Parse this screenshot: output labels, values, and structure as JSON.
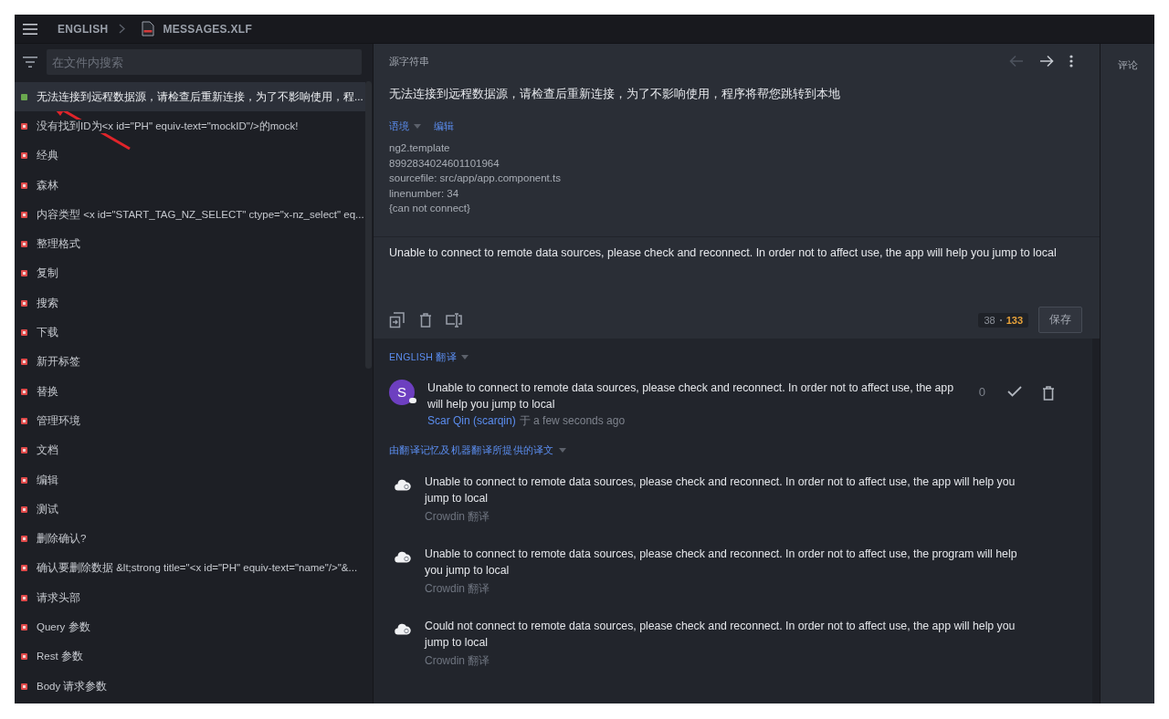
{
  "topbar": {
    "breadcrumb": [
      "ENGLISH",
      "MESSAGES.XLF"
    ]
  },
  "sidebar": {
    "search": {
      "placeholder": "在文件内搜索"
    },
    "items": [
      {
        "text": "无法连接到远程数据源，请检查后重新连接，为了不影响使用，程...",
        "translated": true,
        "selected": true
      },
      {
        "text": "没有找到ID为<x id=\"PH\" equiv-text=\"mockID\"/>的mock!",
        "translated": false,
        "selected": false
      },
      {
        "text": "经典",
        "translated": false,
        "selected": false
      },
      {
        "text": "森林",
        "translated": false,
        "selected": false
      },
      {
        "text": "内容类型 <x id=\"START_TAG_NZ_SELECT\" ctype=\"x-nz_select\" eq...",
        "translated": false,
        "selected": false
      },
      {
        "text": "整理格式",
        "translated": false,
        "selected": false
      },
      {
        "text": "复制",
        "translated": false,
        "selected": false
      },
      {
        "text": "搜索",
        "translated": false,
        "selected": false
      },
      {
        "text": "下载",
        "translated": false,
        "selected": false
      },
      {
        "text": "新开标签",
        "translated": false,
        "selected": false
      },
      {
        "text": "替换",
        "translated": false,
        "selected": false
      },
      {
        "text": "管理环境",
        "translated": false,
        "selected": false
      },
      {
        "text": "文档",
        "translated": false,
        "selected": false
      },
      {
        "text": "编辑",
        "translated": false,
        "selected": false
      },
      {
        "text": "测试",
        "translated": false,
        "selected": false
      },
      {
        "text": "删除确认?",
        "translated": false,
        "selected": false
      },
      {
        "text": "确认要删除数据 &lt;strong title=\"<x id=\"PH\" equiv-text=\"name\"/>\"&...",
        "translated": false,
        "selected": false
      },
      {
        "text": "请求头部",
        "translated": false,
        "selected": false
      },
      {
        "text": "Query 参数",
        "translated": false,
        "selected": false
      },
      {
        "text": "Rest 参数",
        "translated": false,
        "selected": false
      },
      {
        "text": "Body 请求参数",
        "translated": false,
        "selected": false
      }
    ]
  },
  "source": {
    "label": "源字符串",
    "nav": {
      "previous_disabled": true,
      "next_disabled": false
    },
    "text": "无法连接到远程数据源，请检查后重新连接，为了不影响使用，程序将帮您跳转到本地",
    "context_tabs": [
      {
        "label": "语境",
        "kind": "dropdown"
      },
      {
        "label": "编辑",
        "kind": "link"
      }
    ],
    "context_lines": [
      "ng2.template",
      "8992834024601101964",
      "sourcefile: src/app/app.component.ts",
      "linenumber: 34",
      "{can not connect}"
    ]
  },
  "editor": {
    "value": "Unable to connect to remote data sources, please check and reconnect. In order not to affect use, the app will help you jump to local",
    "counter": {
      "source_length": "38",
      "target_length": "133"
    },
    "save_label": "保存"
  },
  "translations": {
    "heading": "ENGLISH 翻译",
    "items": [
      {
        "avatar": "S",
        "text": "Unable to connect to remote data sources, please check and reconnect. In order not to affect use, the app will help you jump to local",
        "author": "Scar Qin (scarqin)",
        "time_prefix": "于",
        "time": "a few seconds ago",
        "votes": "0"
      }
    ]
  },
  "suggestions": {
    "heading": "由翻译记忆及机器翻译所提供的译文",
    "items": [
      {
        "text": "Unable to connect to remote data sources, please check and reconnect. In order not to affect use, the app will help you jump to local",
        "source": "Crowdin 翻译"
      },
      {
        "text": "Unable to connect to remote data sources, please check and reconnect. In order not to affect use, the program will help you jump to local",
        "source": "Crowdin 翻译"
      },
      {
        "text": "Could not connect to remote data sources, please check and reconnect. In order not to affect use, the app will help you jump to local",
        "source": "Crowdin 翻译"
      }
    ]
  },
  "comments": {
    "label": "评论"
  }
}
